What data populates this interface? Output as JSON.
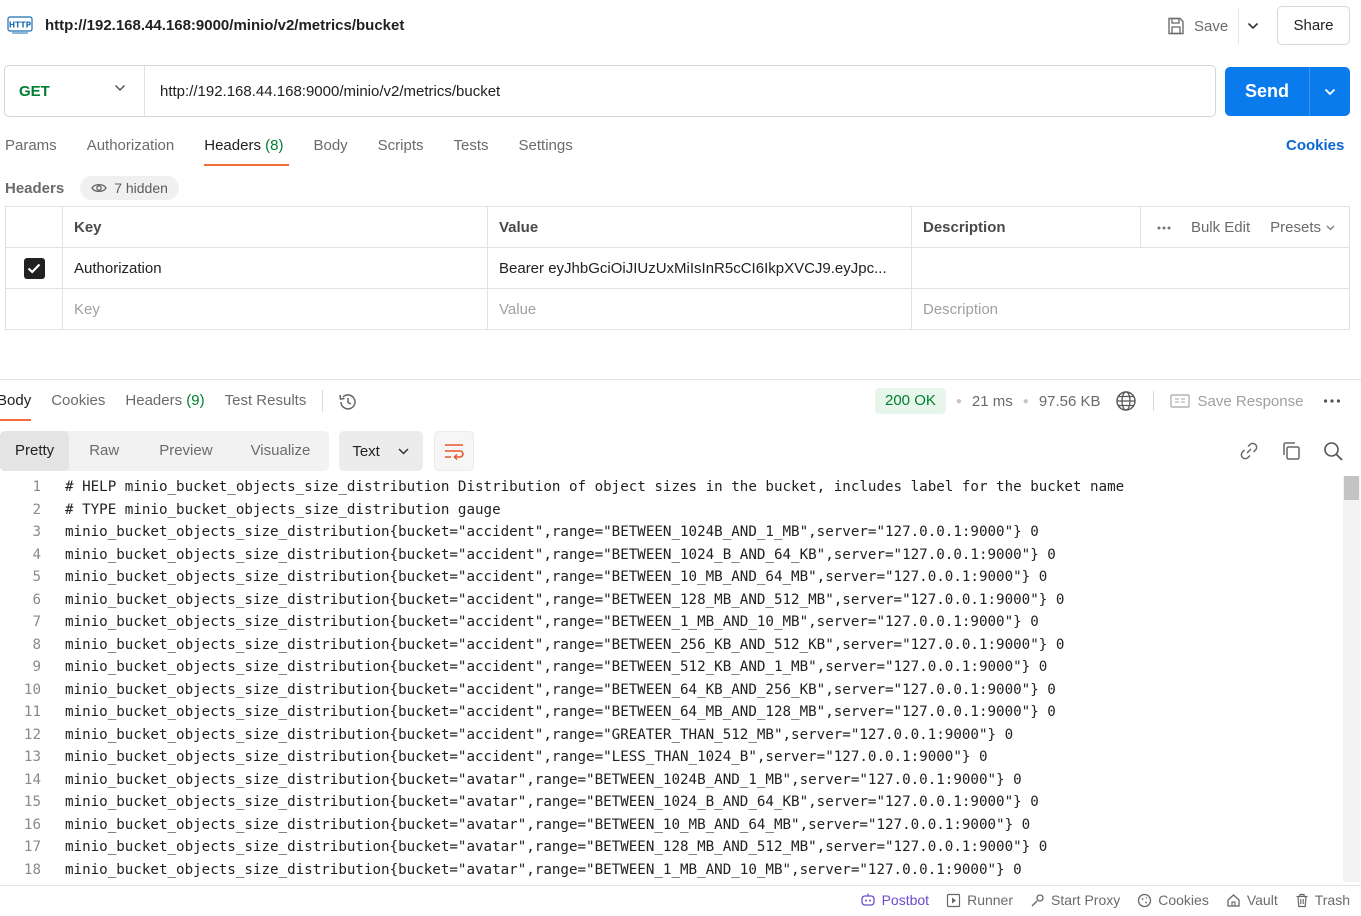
{
  "title": {
    "badge": "HTTP",
    "url": "http://192.168.44.168:9000/minio/v2/metrics/bucket",
    "save_label": "Save",
    "share_label": "Share"
  },
  "request": {
    "method": "GET",
    "url": "http://192.168.44.168:9000/minio/v2/metrics/bucket",
    "send_label": "Send",
    "tabs": [
      {
        "label": "Params",
        "count": ""
      },
      {
        "label": "Authorization",
        "count": ""
      },
      {
        "label": "Headers",
        "count": "(8)"
      },
      {
        "label": "Body",
        "count": ""
      },
      {
        "label": "Scripts",
        "count": ""
      },
      {
        "label": "Tests",
        "count": ""
      },
      {
        "label": "Settings",
        "count": ""
      }
    ],
    "active_tab": "Headers",
    "cookies_link": "Cookies",
    "headers_label": "Headers",
    "hidden_label": "7 hidden",
    "table": {
      "columns": [
        "Key",
        "Value",
        "Description"
      ],
      "bulk_edit": "Bulk Edit",
      "presets": "Presets",
      "rows": [
        {
          "checked": true,
          "key": "Authorization",
          "value": "Bearer eyJhbGciOiJIUzUxMiIsInR5cCI6IkpXVCJ9.eyJpc...",
          "description": ""
        }
      ],
      "placeholder": {
        "key": "Key",
        "value": "Value",
        "description": "Description"
      }
    }
  },
  "response": {
    "tabs": [
      {
        "label": "Body",
        "count": ""
      },
      {
        "label": "Cookies",
        "count": ""
      },
      {
        "label": "Headers",
        "count": "(9)"
      },
      {
        "label": "Test Results",
        "count": ""
      }
    ],
    "status": "200 OK",
    "time": "21 ms",
    "size": "97.56 KB",
    "save_response": "Save Response",
    "views": [
      "Pretty",
      "Raw",
      "Preview",
      "Visualize"
    ],
    "active_view": "Pretty",
    "format": "Text",
    "lines": [
      "# HELP minio_bucket_objects_size_distribution Distribution of object sizes in the bucket, includes label for the bucket name",
      "# TYPE minio_bucket_objects_size_distribution gauge",
      "minio_bucket_objects_size_distribution{bucket=\"accident\",range=\"BETWEEN_1024B_AND_1_MB\",server=\"127.0.0.1:9000\"} 0",
      "minio_bucket_objects_size_distribution{bucket=\"accident\",range=\"BETWEEN_1024_B_AND_64_KB\",server=\"127.0.0.1:9000\"} 0",
      "minio_bucket_objects_size_distribution{bucket=\"accident\",range=\"BETWEEN_10_MB_AND_64_MB\",server=\"127.0.0.1:9000\"} 0",
      "minio_bucket_objects_size_distribution{bucket=\"accident\",range=\"BETWEEN_128_MB_AND_512_MB\",server=\"127.0.0.1:9000\"} 0",
      "minio_bucket_objects_size_distribution{bucket=\"accident\",range=\"BETWEEN_1_MB_AND_10_MB\",server=\"127.0.0.1:9000\"} 0",
      "minio_bucket_objects_size_distribution{bucket=\"accident\",range=\"BETWEEN_256_KB_AND_512_KB\",server=\"127.0.0.1:9000\"} 0",
      "minio_bucket_objects_size_distribution{bucket=\"accident\",range=\"BETWEEN_512_KB_AND_1_MB\",server=\"127.0.0.1:9000\"} 0",
      "minio_bucket_objects_size_distribution{bucket=\"accident\",range=\"BETWEEN_64_KB_AND_256_KB\",server=\"127.0.0.1:9000\"} 0",
      "minio_bucket_objects_size_distribution{bucket=\"accident\",range=\"BETWEEN_64_MB_AND_128_MB\",server=\"127.0.0.1:9000\"} 0",
      "minio_bucket_objects_size_distribution{bucket=\"accident\",range=\"GREATER_THAN_512_MB\",server=\"127.0.0.1:9000\"} 0",
      "minio_bucket_objects_size_distribution{bucket=\"accident\",range=\"LESS_THAN_1024_B\",server=\"127.0.0.1:9000\"} 0",
      "minio_bucket_objects_size_distribution{bucket=\"avatar\",range=\"BETWEEN_1024B_AND_1_MB\",server=\"127.0.0.1:9000\"} 0",
      "minio_bucket_objects_size_distribution{bucket=\"avatar\",range=\"BETWEEN_1024_B_AND_64_KB\",server=\"127.0.0.1:9000\"} 0",
      "minio_bucket_objects_size_distribution{bucket=\"avatar\",range=\"BETWEEN_10_MB_AND_64_MB\",server=\"127.0.0.1:9000\"} 0",
      "minio_bucket_objects_size_distribution{bucket=\"avatar\",range=\"BETWEEN_128_MB_AND_512_MB\",server=\"127.0.0.1:9000\"} 0",
      "minio_bucket_objects_size_distribution{bucket=\"avatar\",range=\"BETWEEN_1_MB_AND_10_MB\",server=\"127.0.0.1:9000\"} 0"
    ]
  },
  "statusbar": {
    "items": [
      "Postbot",
      "Runner",
      "Start Proxy",
      "Cookies",
      "Vault",
      "Trash"
    ]
  },
  "colors": {
    "accent": "#097bed",
    "method_get": "#007f31",
    "tab_underline": "#f26b3a",
    "postbot": "#6c4ad0"
  },
  "icons": {
    "title": "http-icon",
    "save": "save-icon",
    "history": "history-icon",
    "globe": "globe-icon",
    "wrap": "wrap-lines-icon",
    "copy_link": "link-icon",
    "copy": "copy-icon",
    "search": "search-icon"
  }
}
